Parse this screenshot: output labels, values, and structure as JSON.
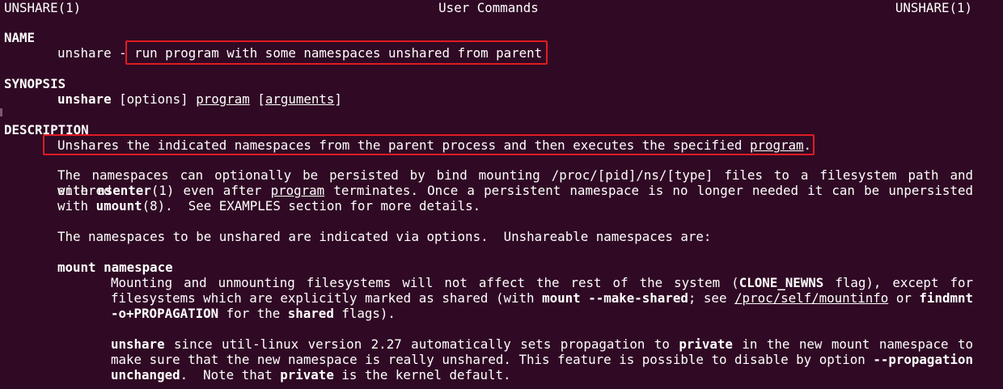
{
  "header": {
    "left": "UNSHARE(1)",
    "center": "User Commands",
    "right": "UNSHARE(1)"
  },
  "name_section": {
    "heading": "NAME",
    "cmd": "unshare",
    "dash": " - ",
    "desc": "run program with some namespaces unshared from parent"
  },
  "synopsis": {
    "heading": "SYNOPSIS",
    "cmd": "unshare",
    "options": " [options] ",
    "program": "program",
    "open": " [",
    "arguments": "arguments",
    "close": "]"
  },
  "description": {
    "heading": "DESCRIPTION",
    "line1_a": "Unshares the indicated namespaces from the parent process and then executes the specified ",
    "line1_prog": "program",
    "line1_b": ".",
    "p2_l1": "The namespaces can optionally be persisted by bind mounting /proc/[pid]/ns/[type] files to a filesystem path and entered",
    "p2_l2_a": "with ",
    "p2_l2_nsenter": "nsenter",
    "p2_l2_b": "(1) even after ",
    "p2_l2_prog": "program",
    "p2_l2_c": " terminates.  Once a persistent namespace is no longer needed it  can  be  unpersisted",
    "p2_l3_a": "with ",
    "p2_l3_umount": "umount",
    "p2_l3_b": "(8).  See EXAMPLES section for more details.",
    "p3": "The namespaces to be unshared are indicated via options.  Unshareable namespaces are:"
  },
  "mount": {
    "title": "mount namespace",
    "l1_a": "Mounting  and  unmounting  filesystems  will  not  affect  the  rest of the system (",
    "l1_flag": "CLONE_NEWNS",
    "l1_b": " flag), except for",
    "l2_a": "filesystems which are explicitly marked as shared (with ",
    "l2_cmd": "mount --make-shared",
    "l2_b": "; see ",
    "l2_path": "/proc/self/mountinfo",
    "l2_c": " or  ",
    "l2_findmnt": "findmnt",
    "l3_opt": "-o+PROPAGATION",
    "l3_a": " for the ",
    "l3_shared": "shared",
    "l3_b": " flags).",
    "p2_l1_cmd": "unshare",
    "p2_l1_a": "  since  util-linux  version  2.27 automatically sets propagation to ",
    "p2_l1_private": "private",
    "p2_l1_b": " in the new mount namespace to",
    "p2_l2_a": "make sure that the new namespace is really unshared. This feature is possible to disable by option  ",
    "p2_l2_opt": "--propagation",
    "p2_l3_unchanged": "unchanged",
    "p2_l3_a": ".  Note that ",
    "p2_l3_private": "private",
    "p2_l3_b": " is the kernel default."
  },
  "colors": {
    "background": "#300a24",
    "text": "#ffffff",
    "highlight": "#e01b24"
  }
}
